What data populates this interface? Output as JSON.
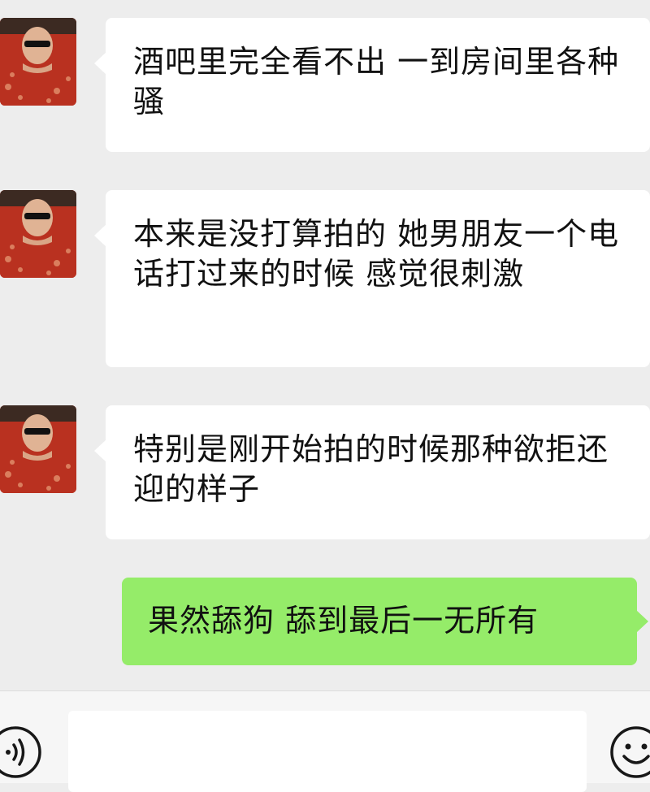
{
  "messages": [
    {
      "side": "in",
      "text": "酒吧里完全看不出 一到房间里各种骚"
    },
    {
      "side": "in",
      "text": "本来是没打算拍的 她男朋友一个电话打过来的时候 感觉很刺激"
    },
    {
      "side": "in",
      "text": "特别是刚开始拍的时候那种欲拒还迎的样子"
    },
    {
      "side": "out",
      "text": "果然舔狗 舔到最后一无所有"
    }
  ],
  "input": {
    "value": "",
    "placeholder": ""
  },
  "icons": {
    "voice": "voice-icon",
    "emoji": "emoji-icon"
  },
  "colors": {
    "background": "#ededed",
    "incoming_bubble": "#ffffff",
    "outgoing_bubble": "#95ec69"
  }
}
